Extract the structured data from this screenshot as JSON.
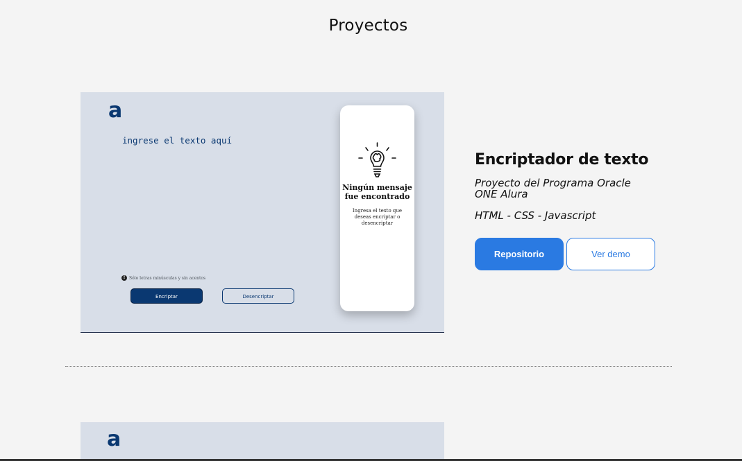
{
  "section": {
    "title": "Proyectos"
  },
  "projects": [
    {
      "preview": {
        "logo": "a",
        "textarea_placeholder": "ingrese el texto aquí",
        "note": "Sólo letras minúsculas y sin acentos",
        "encrypt_label": "Encriptar",
        "decrypt_label": "Desencriptar",
        "result_title": "Ningún mensaje fue encontrado",
        "result_sub": "Ingresa el texto que deseas encriptar o desencriptar"
      },
      "name": "Encriptador de texto",
      "description": "Proyecto del Programa Oracle ONE Alura",
      "tech": "HTML - CSS - Javascript",
      "repo_label": "Repositorio",
      "demo_label": "Ver demo"
    },
    {
      "preview": {
        "logo": "a"
      }
    }
  ],
  "colors": {
    "background": "#f4f4f4",
    "preview_bg": "#d8dee8",
    "alura_blue": "#0a3871",
    "accent": "#2a7ae2"
  }
}
